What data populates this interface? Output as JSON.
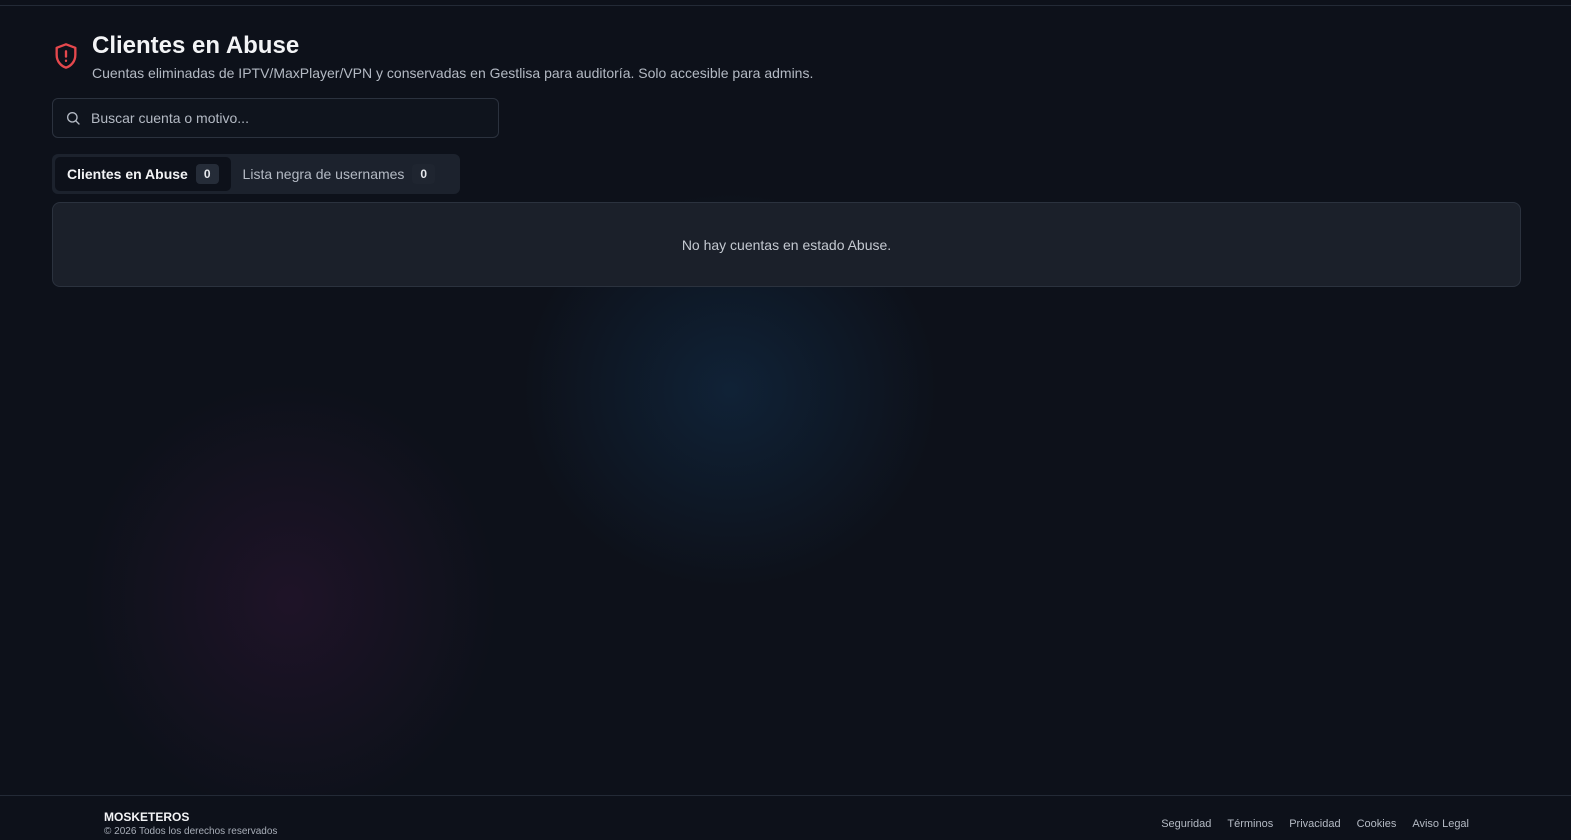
{
  "colors": {
    "background": "#0d111a",
    "accent_danger": "#e5484d",
    "panel": "#1b202a",
    "border": "#2b323e"
  },
  "header": {
    "icon": "shield-alert-icon",
    "title": "Clientes en Abuse",
    "subtitle": "Cuentas eliminadas de IPTV/MaxPlayer/VPN y conservadas en Gestlisa para auditoría. Solo accesible para admins."
  },
  "search": {
    "icon": "search-icon",
    "placeholder": "Buscar cuenta o motivo...",
    "value": ""
  },
  "tabs": [
    {
      "label": "Clientes en Abuse",
      "count": "0",
      "active": true
    },
    {
      "label": "Lista negra de usernames",
      "count": "0",
      "active": false
    }
  ],
  "empty_state": {
    "message": "No hay cuentas en estado Abuse."
  },
  "footer": {
    "brand": "MOSKETEROS",
    "copyright": "© 2026 Todos los derechos reservados",
    "links": [
      "Seguridad",
      "Términos",
      "Privacidad",
      "Cookies",
      "Aviso Legal"
    ]
  }
}
